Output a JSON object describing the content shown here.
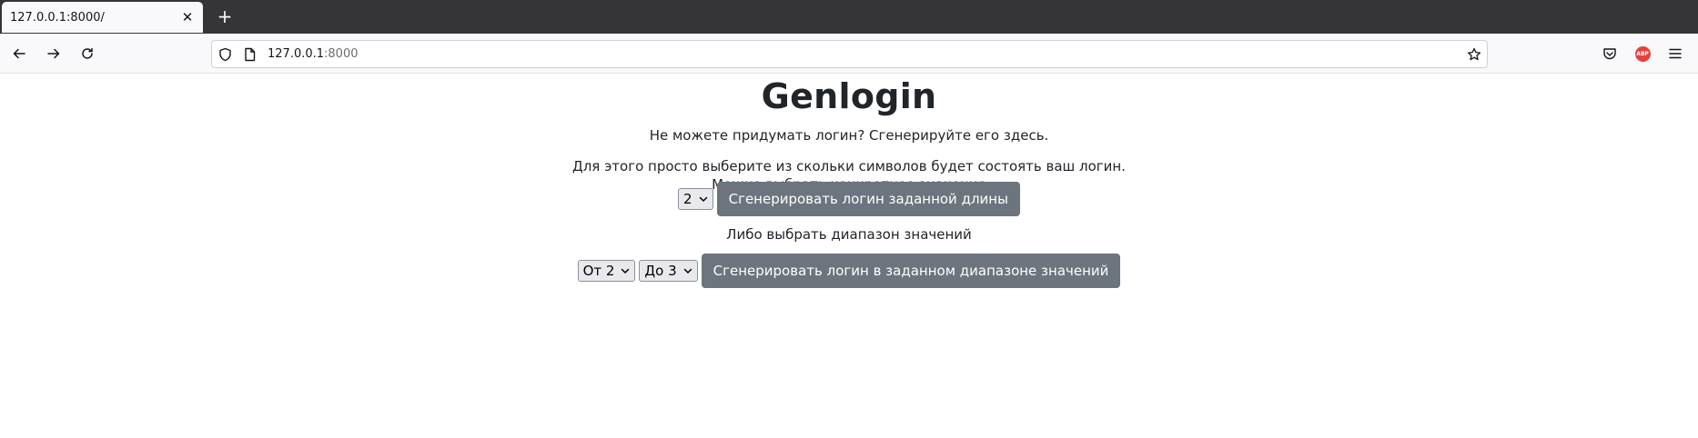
{
  "browser": {
    "tab_title": "127.0.0.1:8000/",
    "url_host": "127.0.0.1",
    "url_port": ":8000"
  },
  "page": {
    "title": "Genlogin",
    "subtitle": "Не можете придумать логин? Сгенерируйте его здесь.",
    "instruction_line1": "Для этого просто выберите из скольки символов будет состоять ваш логин.",
    "instruction_line2": "Можно выбрать конкретное значение",
    "single": {
      "length_value": "2",
      "button_label": "Сгенерировать логин заданной длины"
    },
    "range_label": "Либо выбрать диапазон значений",
    "range": {
      "from_value": "От 2",
      "to_value": "До 3",
      "button_label": "Сгенерировать логин в заданном диапазоне значений"
    }
  },
  "colors": {
    "button_bg": "#6c757d",
    "text": "#212529",
    "tabbar": "#353438",
    "abp_badge": "#e6413a"
  },
  "icons": {
    "abp_label": "ABP"
  }
}
